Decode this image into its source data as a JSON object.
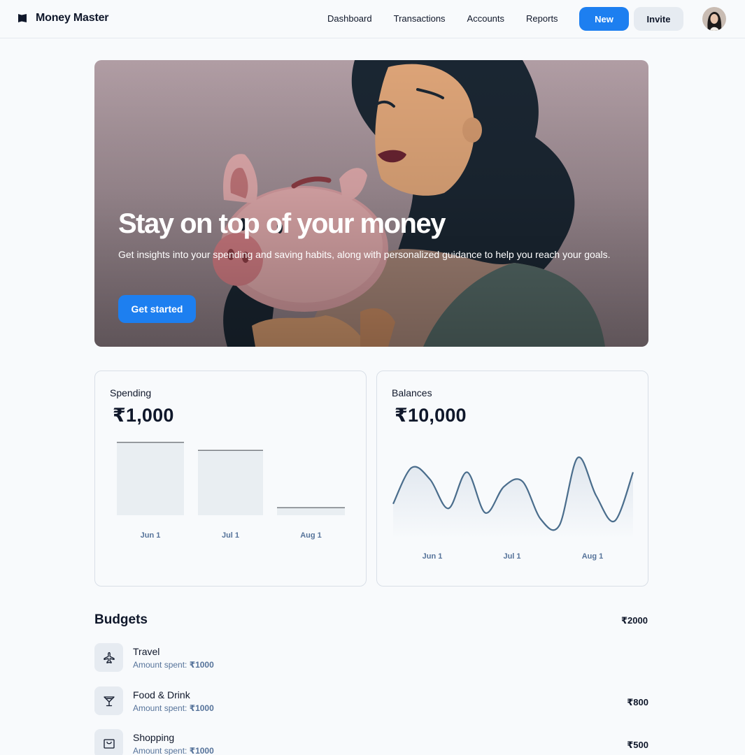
{
  "app": {
    "name": "Money Master"
  },
  "nav": [
    "Dashboard",
    "Transactions",
    "Accounts",
    "Reports"
  ],
  "header_buttons": {
    "new": "New",
    "invite": "Invite"
  },
  "hero": {
    "title": "Stay on top of your money",
    "subtitle": "Get insights into your spending and saving habits, along with personalized guidance to help you reach your goals.",
    "cta": "Get started"
  },
  "spending": {
    "title": "Spending",
    "amount": "₹1,000"
  },
  "balances": {
    "title": "Balances",
    "amount": "₹10,000"
  },
  "chart_data": [
    {
      "type": "bar",
      "categories": [
        "Jun 1",
        "Jul 1",
        "Aug 1"
      ],
      "values": [
        100,
        89,
        11
      ],
      "ylim": [
        0,
        100
      ]
    },
    {
      "type": "area",
      "x_ticks": [
        "Jun 1",
        "Jul 1",
        "Aug 1"
      ],
      "values": [
        28,
        68,
        55,
        23,
        63,
        18,
        47,
        53,
        11,
        4,
        79,
        37,
        9,
        63
      ],
      "ylim": [
        0,
        85
      ]
    }
  ],
  "budgets": {
    "title": "Budgets",
    "total": "₹2000",
    "items": [
      {
        "name": "Travel",
        "spent_label": "Amount spent:",
        "spent": "₹1000",
        "value": "",
        "icon": "airplane-icon"
      },
      {
        "name": "Food & Drink",
        "spent_label": "Amount spent:",
        "spent": "₹1000",
        "value": "₹800",
        "icon": "cocktail-glass-icon"
      },
      {
        "name": "Shopping",
        "spent_label": "Amount spent:",
        "spent": "₹1000",
        "value": "₹500",
        "icon": "shopping-bag-icon"
      }
    ]
  },
  "colors": {
    "primary": "#1d7ff0",
    "muted_text": "#56739a",
    "line": "#4a6d8c",
    "bar": "#e9eef2"
  }
}
